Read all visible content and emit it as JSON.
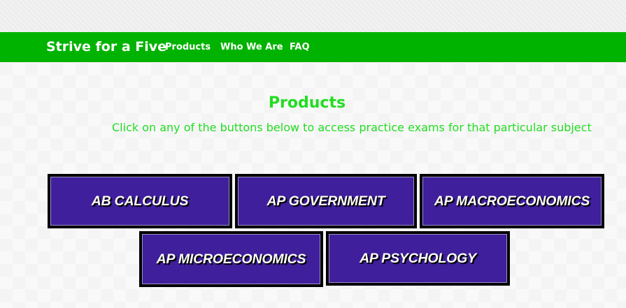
{
  "navbar": {
    "brand": "Strive for a Five",
    "links": [
      {
        "label": "Products"
      },
      {
        "label": "Who We Are"
      },
      {
        "label": "FAQ"
      }
    ],
    "color": "#00b300"
  },
  "main": {
    "title": "Products",
    "subtitle": "Click on any of the buttons below to access practice exams for that particular subject",
    "text_color": "#22dd22"
  },
  "subjects": [
    {
      "label": "AB CALCULUS"
    },
    {
      "label": "AP GOVERNMENT"
    },
    {
      "label": "AP MACROECONOMICS"
    },
    {
      "label": "AP MICROECONOMICS"
    },
    {
      "label": "AP PSYCHOLOGY"
    }
  ],
  "colors": {
    "button_fill": "#3f1f9c",
    "button_border": "#000000"
  }
}
